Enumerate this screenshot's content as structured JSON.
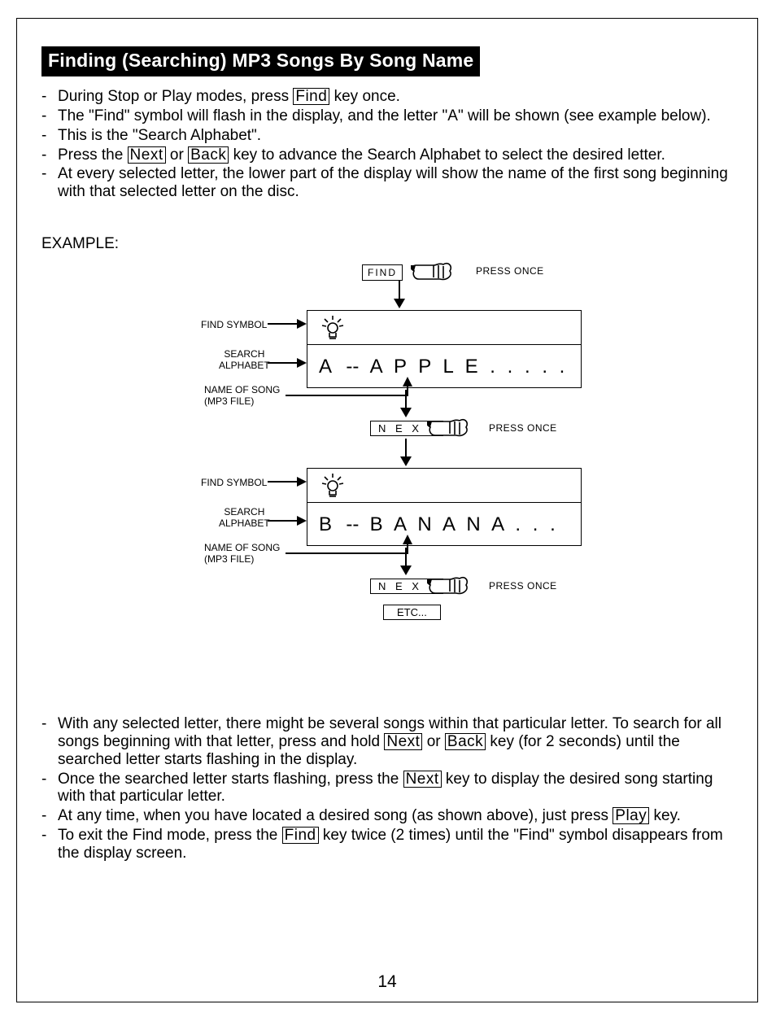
{
  "title": "Finding (Searching) MP3 Songs By Song Name",
  "bullets_top": [
    {
      "pre": "During Stop or Play modes, press ",
      "key": "Find",
      "post": " key once."
    },
    {
      "text": "The \"Find\" symbol will flash in the display, and the letter \"A\" will be shown (see example below)."
    },
    {
      "text": "This is the \"Search Alphabet\"."
    },
    {
      "pre": "Press the ",
      "key": "Next",
      "mid": " or ",
      "key2": "Back",
      "post": " key to advance the Search Alphabet to select the desired letter."
    },
    {
      "text": "At every selected letter, the lower part of the display will show the name of the first song beginning with that selected letter on the disc."
    }
  ],
  "example_label": "EXAMPLE:",
  "diagram": {
    "find_btn": "FIND",
    "next_btn": "N E X T",
    "press_once": "PRESS ONCE",
    "labels": {
      "find_symbol": "FIND SYMBOL",
      "search_alphabet": "SEARCH\nALPHABET",
      "name_of_song": "NAME OF SONG\n(MP3 FILE)"
    },
    "rows": [
      {
        "letter": "A",
        "song": "A P P L E  .  .  .  .  ."
      },
      {
        "letter": "B",
        "song": "B A N A N A  .  .  ."
      }
    ],
    "etc": "ETC..."
  },
  "bullets_bottom": [
    {
      "pre": "With any selected letter, there might be several songs within that particular letter.  To search for all songs beginning with that letter, press and hold ",
      "key": "Next",
      "mid": " or ",
      "key2": "Back",
      "post": " key (for 2 seconds) until the searched letter starts flashing in the display."
    },
    {
      "pre": "Once the searched letter starts flashing, press the ",
      "key": "Next",
      "post": " key to display the desired song starting with that particular letter."
    },
    {
      "pre": "At any time, when you have located a desired song (as shown above), just press ",
      "key": "Play",
      "post": " key."
    },
    {
      "pre": "To exit the Find mode, press the ",
      "key": "Find",
      "post": " key twice (2 times) until the \"Find\" symbol disappears from the display screen."
    }
  ],
  "page_number": "14"
}
